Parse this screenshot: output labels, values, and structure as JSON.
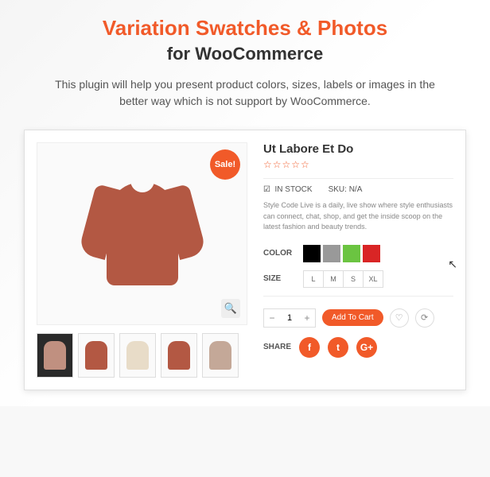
{
  "heading": {
    "title_orange": "Variation Swatches & Photos",
    "title_dark": "for WooCommerce"
  },
  "subtitle": "This plugin will help you present product colors, sizes, labels or images in the better way which is not support by WooCommerce.",
  "product": {
    "sale_badge": "Sale!",
    "title": "Ut Labore Et Do",
    "stars": "☆☆☆☆☆",
    "stock_icon": "☑",
    "stock_label": "IN STOCK",
    "sku_label": "SKU:",
    "sku_value": "N/A",
    "description": "Style Code Live is a daily, live show where style enthusiasts can connect, chat, shop, and get the inside scoop on the latest fashion and beauty trends.",
    "color_label": "COLOR",
    "size_label": "SIZE",
    "qty_value": "1",
    "add_to_cart": "Add To Cart",
    "share_label": "SHARE",
    "colors": [
      "#000000",
      "#999999",
      "#6bc441",
      "#d92525"
    ],
    "sizes": [
      "L",
      "M",
      "S",
      "XL"
    ],
    "thumbs": [
      {
        "bg": "dark",
        "color": "#c09080"
      },
      {
        "bg": "light",
        "color": "#b35843"
      },
      {
        "bg": "light",
        "color": "#e8dcc8"
      },
      {
        "bg": "light",
        "color": "#b35843"
      },
      {
        "bg": "light",
        "color": "#c4a898"
      }
    ],
    "social": {
      "facebook": "f",
      "twitter": "t",
      "google": "G+"
    }
  }
}
